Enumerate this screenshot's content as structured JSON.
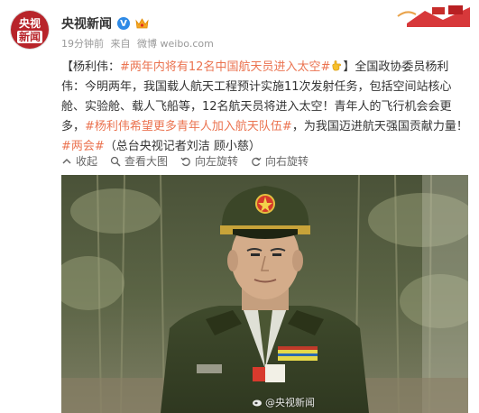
{
  "post": {
    "username": "央视新闻",
    "avatar_line1": "央视",
    "avatar_line2": "新闻",
    "time": "19分钟前",
    "source_prefix": "来自",
    "source": "微博 weibo.com",
    "segments": [
      {
        "text": "【杨利伟：",
        "type": "plain"
      },
      {
        "text": "#两年内将有12名中国航天员进入太空#",
        "type": "link"
      },
      {
        "text": "】全国政协委员杨利伟：今明两年，我国载人航天工程预计实施11次发射任务，包括空间站核心舱、实验舱、载人飞船等，12名航天员将进入太空！青年人的飞行机会会更多，",
        "type": "plain"
      },
      {
        "text": "#杨利伟希望更多青年人加入航天队伍#",
        "type": "link"
      },
      {
        "text": "，为我国迈进航天强国贡献力量！",
        "type": "plain"
      },
      {
        "text": "#两会#",
        "type": "link"
      },
      {
        "text": "（总台央视记者刘洁 顾小慈）",
        "type": "plain"
      }
    ],
    "watermark": "@央视新闻"
  },
  "actions": [
    {
      "label": "收起",
      "icon": "collapse-icon"
    },
    {
      "label": "查看大图",
      "icon": "magnify-icon"
    },
    {
      "label": "向左旋转",
      "icon": "rotate-left-icon"
    },
    {
      "label": "向右旋转",
      "icon": "rotate-right-icon"
    }
  ],
  "colors": {
    "link": "#eb7350",
    "verified": "#2e8ae6",
    "brand_red": "#b8242a"
  }
}
